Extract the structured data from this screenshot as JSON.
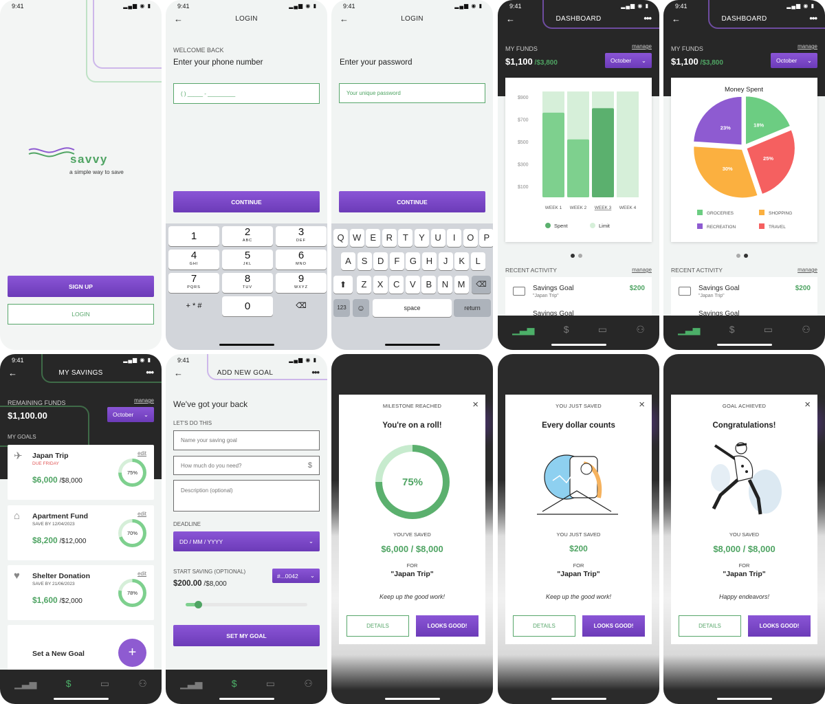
{
  "status_time": "9:41",
  "status_icons": "▂▄▆ ◉ ▮",
  "splash": {
    "brand": "savvy",
    "tagline": "a simple way to save",
    "signup": "SIGN UP",
    "login": "LOGIN"
  },
  "login_phone": {
    "title": "LOGIN",
    "welcome": "WELCOME BACK",
    "prompt": "Enter your phone number",
    "placeholder": "(       )  _____ - _________",
    "continue": "CONTINUE",
    "keys": [
      {
        "n": "1",
        "l": ""
      },
      {
        "n": "2",
        "l": "ABC"
      },
      {
        "n": "3",
        "l": "DEF"
      },
      {
        "n": "4",
        "l": "GHI"
      },
      {
        "n": "5",
        "l": "JKL"
      },
      {
        "n": "6",
        "l": "MNO"
      },
      {
        "n": "7",
        "l": "PQRS"
      },
      {
        "n": "8",
        "l": "TUV"
      },
      {
        "n": "9",
        "l": "WXYZ"
      },
      {
        "n": "+ * #",
        "l": ""
      },
      {
        "n": "0",
        "l": ""
      },
      {
        "n": "⌫",
        "l": ""
      }
    ]
  },
  "login_password": {
    "title": "LOGIN",
    "prompt": "Enter your password",
    "placeholder": "Your unique password",
    "continue": "CONTINUE",
    "row1": [
      "Q",
      "W",
      "E",
      "R",
      "T",
      "Y",
      "U",
      "I",
      "O",
      "P"
    ],
    "row2": [
      "A",
      "S",
      "D",
      "F",
      "G",
      "H",
      "J",
      "K",
      "L"
    ],
    "row3": [
      "Z",
      "X",
      "C",
      "V",
      "B",
      "N",
      "M"
    ],
    "num": "123",
    "emoji": "☺",
    "space": "space",
    "return": "return",
    "shift": "⬆",
    "delete": "⌫"
  },
  "dashboard": {
    "title": "DASHBOARD",
    "funds_label": "MY FUNDS",
    "manage": "manage",
    "funds": "$1,100",
    "funds_total": " /$3,800",
    "month": "October",
    "recent": "RECENT ACTIVITY",
    "activity_title": "Savings Goal",
    "activity_sub": "\"Japan Trip\"",
    "activity_amount": "$200",
    "activity_next": "Savings Goal"
  },
  "chart_data": [
    {
      "type": "bar",
      "categories": [
        "WEEK 1",
        "WEEK 2",
        "WEEK 3",
        "WEEK 4"
      ],
      "series": [
        {
          "name": "Spent",
          "values": [
            760,
            520,
            800,
            0
          ]
        },
        {
          "name": "Limit",
          "values": [
            950,
            950,
            950,
            950
          ]
        }
      ],
      "yticks": [
        "$900",
        "$700",
        "$500",
        "$300",
        "$100"
      ],
      "legend": "bottom",
      "colors": {
        "spent": "#7ed08e",
        "spent_active": "#5bb06e",
        "limit": "#d6efd9"
      }
    },
    {
      "type": "pie",
      "title": "Money Spent",
      "labels": [
        "GROCERIES",
        "TRAVEL",
        "SHOPPING",
        "RECREATION"
      ],
      "values": [
        18,
        25,
        30,
        23
      ],
      "display": [
        "18%",
        "25%",
        "30%",
        "23%"
      ],
      "colors": [
        "#6ccd82",
        "#f56060",
        "#fbb040",
        "#8e5bd1"
      ],
      "legend": "bottom"
    }
  ],
  "savings": {
    "title": "MY SAVINGS",
    "remaining_label": "REMAINING FUNDS",
    "manage": "manage",
    "remaining": "$1,100.00",
    "month": "October",
    "goals_label": "MY GOALS",
    "goals": [
      {
        "name": "Japan Trip",
        "sub": "DUE FRIDAY",
        "amount": "$6,000",
        "total": " /$8,000",
        "pct": "75%",
        "p": 75,
        "edit": "edit",
        "icon": "✈"
      },
      {
        "name": "Apartment Fund",
        "sub": "SAVE BY 12/04/2023",
        "amount": "$8,200",
        "total": " /$12,000",
        "pct": "70%",
        "p": 70,
        "edit": "edit",
        "icon": "⌂"
      },
      {
        "name": "Shelter Donation",
        "sub": "SAVE BY 21/06/2023",
        "amount": "$1,600",
        "total": " /$2,000",
        "pct": "78%",
        "p": 78,
        "edit": "edit",
        "icon": "♥"
      }
    ],
    "new_goal": "Set a New Goal",
    "plus": "+"
  },
  "add_goal": {
    "title": "ADD NEW GOAL",
    "heading": "We've got your back",
    "lets": "LET'S DO THIS",
    "name_ph": "Name your saving goal",
    "amount_ph": "How much do you need?",
    "desc_ph": "Description (optional)",
    "deadline_label": "DEADLINE",
    "deadline_ph": "DD / MM / YYYY",
    "start_label": "START SAVING (OPTIONAL)",
    "start_amount": "$200.00",
    "start_total": " /$8,000",
    "account": "#...0042",
    "slider": 0.1,
    "submit": "SET MY GOAL"
  },
  "modals": [
    {
      "kicker": "MILESTONE REACHED",
      "title": "You're on a roll!",
      "saved_label": "YOU'VE SAVED",
      "saved": "$6,000 / $8,000",
      "for": "FOR",
      "goal": "\"Japan Trip\"",
      "msg": "Keep up the good work!",
      "details": "DETAILS",
      "ok": "LOOKS GOOD!",
      "pct": "75%",
      "p": 75
    },
    {
      "kicker": "YOU JUST SAVED",
      "title": "Every dollar counts",
      "saved_label": "YOU JUST SAVED",
      "saved": "$200",
      "for": "FOR",
      "goal": "\"Japan Trip\"",
      "msg": "Keep up the good work!",
      "details": "DETAILS",
      "ok": "LOOKS GOOD!"
    },
    {
      "kicker": "GOAL ACHIEVED",
      "title": "Congratulations!",
      "saved_label": "YOU SAVED",
      "saved": "$8,000 / $8,000",
      "for": "FOR",
      "goal": "\"Japan Trip\"",
      "msg": "Happy endeavors!",
      "details": "DETAILS",
      "ok": "LOOKS GOOD!"
    }
  ],
  "nav_icons": [
    "chart-icon",
    "money-bag-icon",
    "card-icon",
    "profile-icon"
  ],
  "colors": {
    "purple": "#7a48c8",
    "green": "#4fa463",
    "dark": "#272727"
  }
}
